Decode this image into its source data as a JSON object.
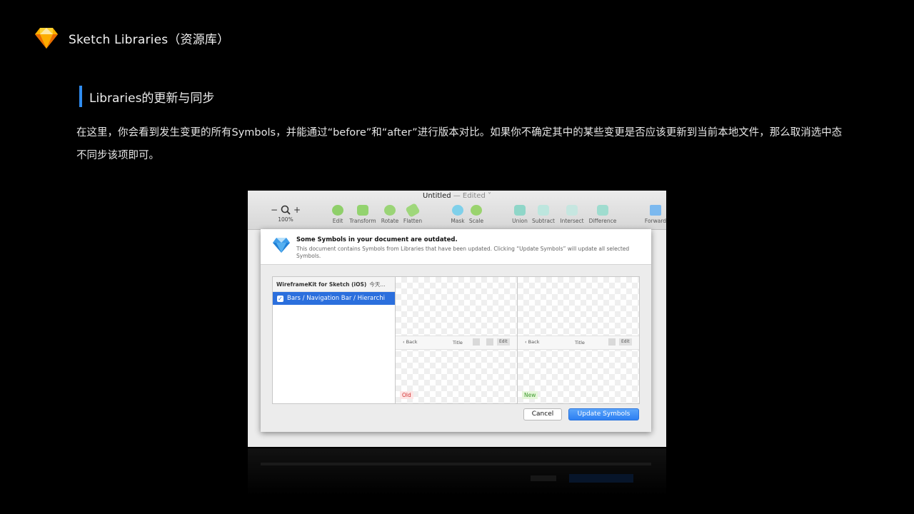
{
  "slide": {
    "title": "Sketch Libraries（资源库）",
    "section_title": "Libraries的更新与同步",
    "paragraph": "在这里，你会看到发生变更的所有Symbols，并能通过“before”和“after”进行版本对比。如果你不确定其中的某些变更是否应该更新到当前本地文件，那么取消选中态不同步该项即可。",
    "accent_color": "#2f8cf0"
  },
  "window": {
    "title": "Untitled",
    "edited": " — Edited ˅",
    "zoom": {
      "minus": "−",
      "plus": "+",
      "value": "100%"
    },
    "toolbar": [
      {
        "label": "Edit",
        "icon": "edit-icon",
        "color": "#8fcf6a"
      },
      {
        "label": "Transform",
        "icon": "transform-icon",
        "color": "#93d36f"
      },
      {
        "label": "Rotate",
        "icon": "rotate-icon",
        "color": "#9ad476"
      },
      {
        "label": "Flatten",
        "icon": "flatten-icon",
        "color": "#9fd77b"
      },
      {
        "label": "Mask",
        "icon": "mask-icon",
        "color": "#7fd0ea"
      },
      {
        "label": "Scale",
        "icon": "scale-icon",
        "color": "#9ad36e"
      },
      {
        "label": "Union",
        "icon": "union-icon",
        "color": "#8fd6c8"
      },
      {
        "label": "Subtract",
        "icon": "subtract-icon",
        "color": "#bde6de"
      },
      {
        "label": "Intersect",
        "icon": "intersect-icon",
        "color": "#c6e6e0"
      },
      {
        "label": "Difference",
        "icon": "difference-icon",
        "color": "#9fdccf"
      },
      {
        "label": "Forward",
        "icon": "forward-icon",
        "color": "#7cb9ef"
      }
    ]
  },
  "alert": {
    "title": "Some Symbols in your document are outdated.",
    "text": "This document contains Symbols from Libraries that have been updated. Clicking “Update Symbols” will update all selected Symbols."
  },
  "library": {
    "name": "WireframeKit for Sketch (iOS)",
    "date": "今天...",
    "items": [
      {
        "label": "Bars / Navigation Bar / Hierarchi",
        "checked": true
      }
    ]
  },
  "preview": {
    "back": "Back",
    "title": "Title",
    "edit": "Edit",
    "old_label": "Old",
    "new_label": "New"
  },
  "buttons": {
    "cancel": "Cancel",
    "update": "Update Symbols"
  }
}
